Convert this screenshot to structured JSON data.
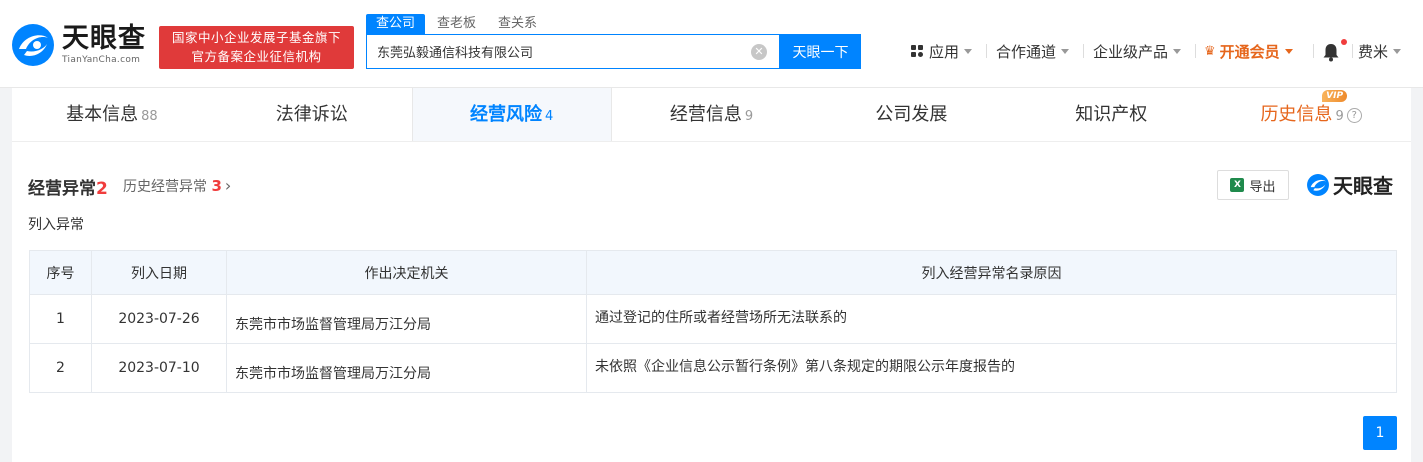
{
  "brand": {
    "name_cn": "天眼查",
    "name_en": "TianYanCha.com"
  },
  "badge": {
    "line1": "国家中小企业发展子基金旗下",
    "line2": "官方备案企业征信机构"
  },
  "search": {
    "tabs": [
      "查公司",
      "查老板",
      "查关系"
    ],
    "value": "东莞弘毅通信科技有限公司",
    "button": "天眼一下"
  },
  "topnav": {
    "apps": "应用",
    "cooperation": "合作通道",
    "enterprise": "企业级产品",
    "vip": "开通会员",
    "user": "费米"
  },
  "tabs": [
    {
      "label": "基本信息",
      "count": "88"
    },
    {
      "label": "法律诉讼",
      "count": ""
    },
    {
      "label": "经营风险",
      "count": "4"
    },
    {
      "label": "经营信息",
      "count": "9"
    },
    {
      "label": "公司发展",
      "count": ""
    },
    {
      "label": "知识产权",
      "count": ""
    },
    {
      "label": "历史信息",
      "count": "9",
      "tag": "VIP"
    }
  ],
  "section": {
    "title": "经营异常",
    "count": "2",
    "history_label": "历史经营异常",
    "history_count": "3",
    "subtitle": "列入异常",
    "export": "导出",
    "brand": "天眼查"
  },
  "table": {
    "headers": [
      "序号",
      "列入日期",
      "作出决定机关",
      "列入经营异常名录原因"
    ],
    "rows": [
      {
        "no": "1",
        "date": "2023-07-26",
        "org": "东莞市市场监督管理局万江分局",
        "reason": "通过登记的住所或者经营场所无法联系的"
      },
      {
        "no": "2",
        "date": "2023-07-10",
        "org": "东莞市市场监督管理局万江分局",
        "reason": "未依照《企业信息公示暂行条例》第八条规定的期限公示年度报告的"
      }
    ]
  },
  "pagination": {
    "current": "1"
  },
  "colors": {
    "primary": "#0084ff",
    "red": "#e03a3a",
    "vip": "#e6661c"
  }
}
